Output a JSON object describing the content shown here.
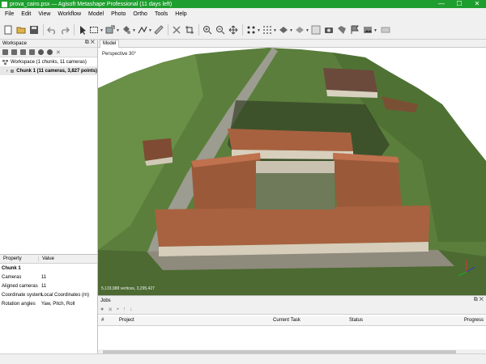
{
  "window": {
    "title": "prova_cairo.psx — Agisoft Metashape Professional (11 days left)",
    "minimize": "—",
    "maximize": "☐",
    "close": "✕"
  },
  "menu": [
    "File",
    "Edit",
    "View",
    "Workflow",
    "Model",
    "Photo",
    "Ortho",
    "Tools",
    "Help"
  ],
  "workspace": {
    "header": "Workspace",
    "root": "Workspace (1 chunks, 11 cameras)",
    "chunk": "Chunk 1 (11 cameras, 3,827 points)"
  },
  "properties": {
    "col_property": "Property",
    "col_value": "Value",
    "rows": [
      {
        "k": "Chunk 1",
        "v": "",
        "group": true
      },
      {
        "k": "Cameras",
        "v": "11"
      },
      {
        "k": "Aligned cameras",
        "v": "11"
      },
      {
        "k": "Coordinate system",
        "v": "Local Coordinates (m)"
      },
      {
        "k": "Rotation angles",
        "v": "Yaw, Pitch, Roll"
      }
    ]
  },
  "model": {
    "tab": "Model",
    "perspective": "Perspective 30°",
    "overlay_info": "5,133,988 vertices, 3,295,427"
  },
  "jobs": {
    "header": "Jobs",
    "columns": [
      "#",
      "Project",
      "Current Task",
      "Status",
      "Progress"
    ]
  },
  "colors": {
    "titlebar": "#1e9e2e",
    "grass": "#5b7e3c",
    "roof": "#9a5a3a",
    "road": "#9c9c90"
  }
}
